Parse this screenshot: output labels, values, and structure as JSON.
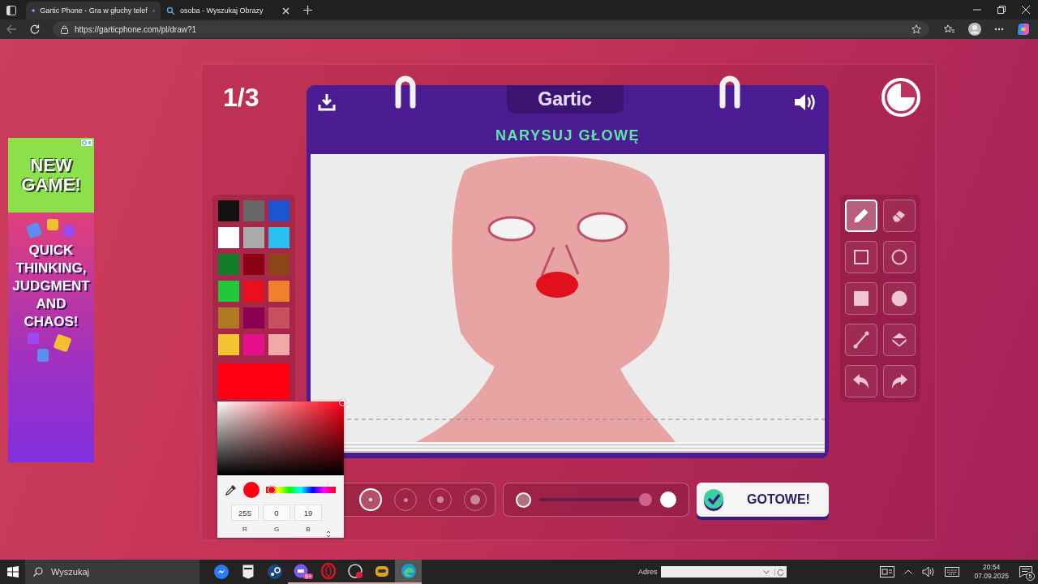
{
  "browser": {
    "tabs": [
      {
        "title": "Gartic Phone - Gra w głuchy telef",
        "selected": true
      },
      {
        "title": "osoba - Wyszukaj Obrazy",
        "selected": false
      }
    ],
    "url": "https://garticphone.com/pl/draw?1"
  },
  "ad": {
    "headline": "NEW GAME!",
    "tagline": "QUICK THINKING, JUDGMENT AND CHAOS!"
  },
  "game": {
    "round": "1/3",
    "logo": "Gartic",
    "prompt": "NARYSUJ GŁOWĘ",
    "palette": [
      {
        "color": "#111111"
      },
      {
        "color": "#666666"
      },
      {
        "color": "#1a56d0"
      },
      {
        "color": "#ffffff"
      },
      {
        "color": "#aaaaaa"
      },
      {
        "color": "#2ac0ef"
      },
      {
        "color": "#147d2a"
      },
      {
        "color": "#8b0013"
      },
      {
        "color": "#8b4516"
      },
      {
        "color": "#22c83c"
      },
      {
        "color": "#e8101c"
      },
      {
        "color": "#f07f2e"
      },
      {
        "color": "#b07a25"
      },
      {
        "color": "#8b0050"
      },
      {
        "color": "#c85060"
      },
      {
        "color": "#f2c531"
      },
      {
        "color": "#e6108a"
      },
      {
        "color": "#f0a8a8"
      }
    ],
    "current_swatch": {
      "color": "#ff0013"
    },
    "picker": {
      "hue_slider": {
        "level": 0.03
      },
      "fields": [
        {
          "value": "255",
          "label": "R"
        },
        {
          "value": "0",
          "label": "G"
        },
        {
          "value": "19",
          "label": "B"
        }
      ]
    },
    "tools": [
      {
        "kind": "pencil",
        "selected": true
      },
      {
        "kind": "eraser",
        "selected": false
      },
      {
        "kind": "rectangle",
        "selected": false
      },
      {
        "kind": "ellipse",
        "selected": false
      },
      {
        "kind": "filled-rectangle",
        "selected": false
      },
      {
        "kind": "filled-ellipse",
        "selected": false
      },
      {
        "kind": "line",
        "selected": false
      },
      {
        "kind": "bucket",
        "selected": false
      },
      {
        "kind": "undo",
        "selected": false
      },
      {
        "kind": "redo",
        "selected": false
      }
    ],
    "sizes": [
      {
        "selected": true
      },
      {
        "selected": false
      },
      {
        "selected": false
      },
      {
        "selected": false
      }
    ],
    "opacity": {
      "level": 0.94
    },
    "done_button": "GOTOWE!"
  },
  "taskbar": {
    "search_placeholder": "Wyszukaj",
    "apps": [
      {
        "kind": "messenger",
        "running": false,
        "selected": false
      },
      {
        "kind": "epic",
        "running": false,
        "selected": false
      },
      {
        "kind": "steam",
        "running": false,
        "selected": false
      },
      {
        "kind": "chat",
        "running": true,
        "selected": false,
        "badge": "9+"
      },
      {
        "kind": "opera",
        "running": true,
        "selected": false
      },
      {
        "kind": "recorder",
        "running": true,
        "selected": false
      },
      {
        "kind": "robot",
        "running": true,
        "selected": false
      },
      {
        "kind": "edge",
        "running": true,
        "selected": true
      }
    ],
    "address_label": "Adres",
    "time": "20:54",
    "date": "07.09.2025",
    "notifications": "5"
  }
}
